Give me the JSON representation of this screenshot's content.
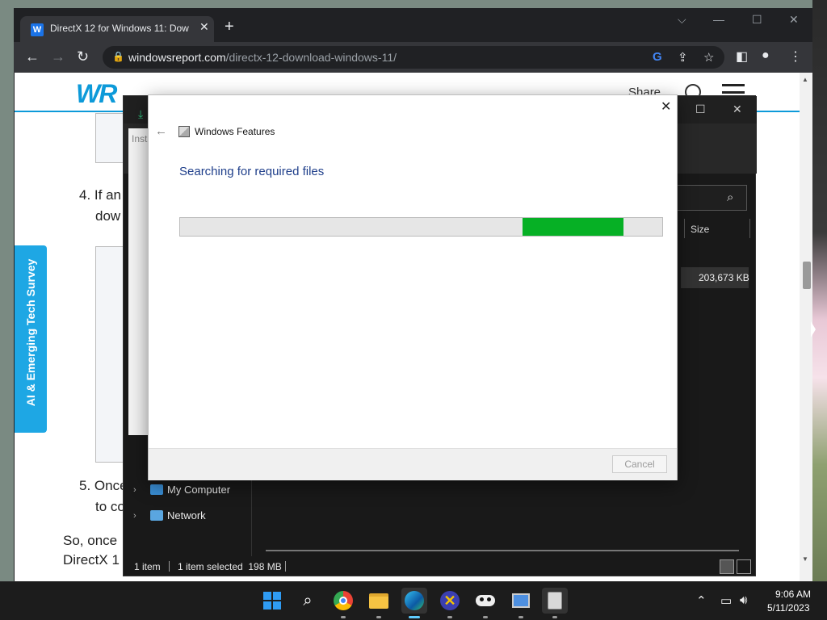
{
  "browser": {
    "tab_title": "DirectX 12 for Windows 11: Dow",
    "tab_favicon": "W",
    "url_host": "windowsreport.com",
    "url_path": "/directx-12-download-windows-11/"
  },
  "page": {
    "logo": "WR",
    "share_label": "Share",
    "side_tab_label": "AI & Emerging Tech Survey",
    "step4_line1": "4. If an",
    "step4_line2": "dow",
    "step5_line1": "5. Once",
    "step5_line2": "to co",
    "para_line1": "So, once",
    "para_line2": "DirectX 1"
  },
  "explorer": {
    "install_fragment": "Insta",
    "column_size": "Size",
    "file_size": "203,673 KB",
    "nav_my_computer": "My Computer",
    "nav_network": "Network",
    "status_count": "1 item",
    "status_selected": "1 item selected  198 MB"
  },
  "dialog": {
    "title": "Windows Features",
    "heading": "Searching for required files",
    "cancel_label": "Cancel",
    "progress": {
      "start_fraction": 0.71,
      "end_fraction": 0.92
    }
  },
  "taskbar": {
    "time": "9:06 AM",
    "date": "5/11/2023"
  },
  "colors": {
    "progress_fill": "#06b025",
    "accent": "#0d9ad9",
    "dialog_heading": "#1e3e8a"
  }
}
